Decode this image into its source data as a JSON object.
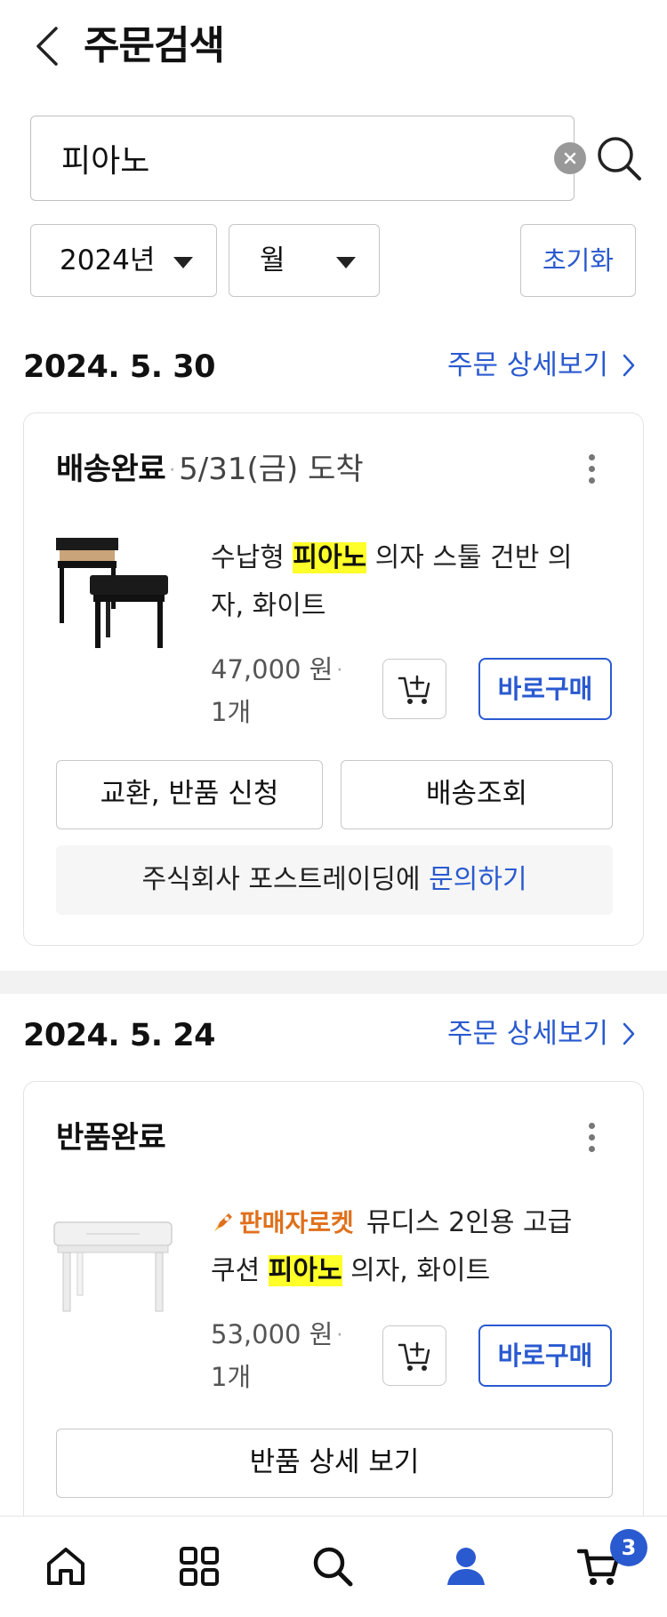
{
  "header": {
    "title": "주문검색"
  },
  "search": {
    "value": "피아노",
    "placeholder": ""
  },
  "filters": {
    "year": "2024년",
    "month": "월",
    "reset_label": "초기화"
  },
  "colors": {
    "accent": "#2a5ad0",
    "highlight": "#ffff29",
    "rocket": "#e0701c",
    "badge": "#2a5ad0"
  },
  "orders": [
    {
      "date": "2024. 5. 30",
      "detail_label": "주문 상세보기",
      "status": "배송완료",
      "arrival": "5/31(금) 도착",
      "product": {
        "title_before": "수납형 ",
        "keyword": "피아노",
        "title_after": " 의자 스툴 건반 의자, 화이트"
      },
      "price": "47,000 원",
      "qty": "1개",
      "buy_label": "바로구매",
      "actions": [
        "교환, 반품 신청",
        "배송조회"
      ],
      "inquiry_text": "주식회사 포스트레이딩에 ",
      "inquiry_link": "문의하기"
    },
    {
      "date": "2024. 5. 24",
      "detail_label": "주문 상세보기",
      "status": "반품완료",
      "product": {
        "rocket_label": "판매자로켓",
        "title_before": "뮤디스 2인용 고급 쿠션 ",
        "keyword": "피아노",
        "title_after": " 의자, 화이트"
      },
      "price": "53,000 원",
      "qty": "1개",
      "buy_label": "바로구매",
      "actions": [
        "반품 상세 보기"
      ]
    }
  ],
  "tabbar": {
    "icons": [
      "home-icon",
      "category-icon",
      "search-icon",
      "my-page-icon",
      "cart-icon"
    ],
    "cart_count": "3"
  }
}
